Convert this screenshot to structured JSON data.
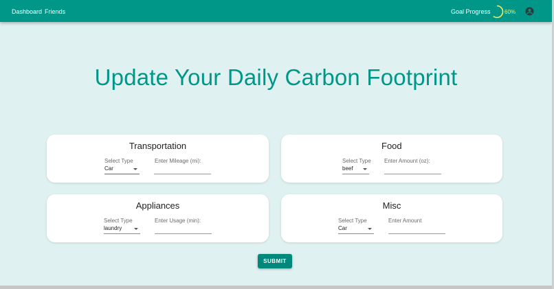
{
  "nav": {
    "dashboard": "Dashboard",
    "friends": "Friends",
    "goal_label": "Goal Progress",
    "goal_percent": "60%",
    "goal_progress": 0.6,
    "account_icon": "account-circle-icon"
  },
  "title": "Update Your Daily Carbon Footprint",
  "cards": {
    "transportation": {
      "title": "Transportation",
      "select_label": "Select Type",
      "select_value": "Car",
      "input_label": "Enter Mileage (mi):"
    },
    "food": {
      "title": "Food",
      "select_label": "Select Type",
      "select_value": "beef",
      "input_label": "Enter Amount (oz):"
    },
    "appliances": {
      "title": "Appliances",
      "select_label": "Select Type",
      "select_value": "laundry",
      "input_label": "Enter Usage (min):"
    },
    "misc": {
      "title": "Misc",
      "select_label": "Select Type",
      "select_value": "Car",
      "input_label": "Enter Amount"
    }
  },
  "submit_label": "SUBMIT",
  "colors": {
    "primary": "#009688",
    "background": "#dff1f0",
    "progress": "#ffee58"
  }
}
